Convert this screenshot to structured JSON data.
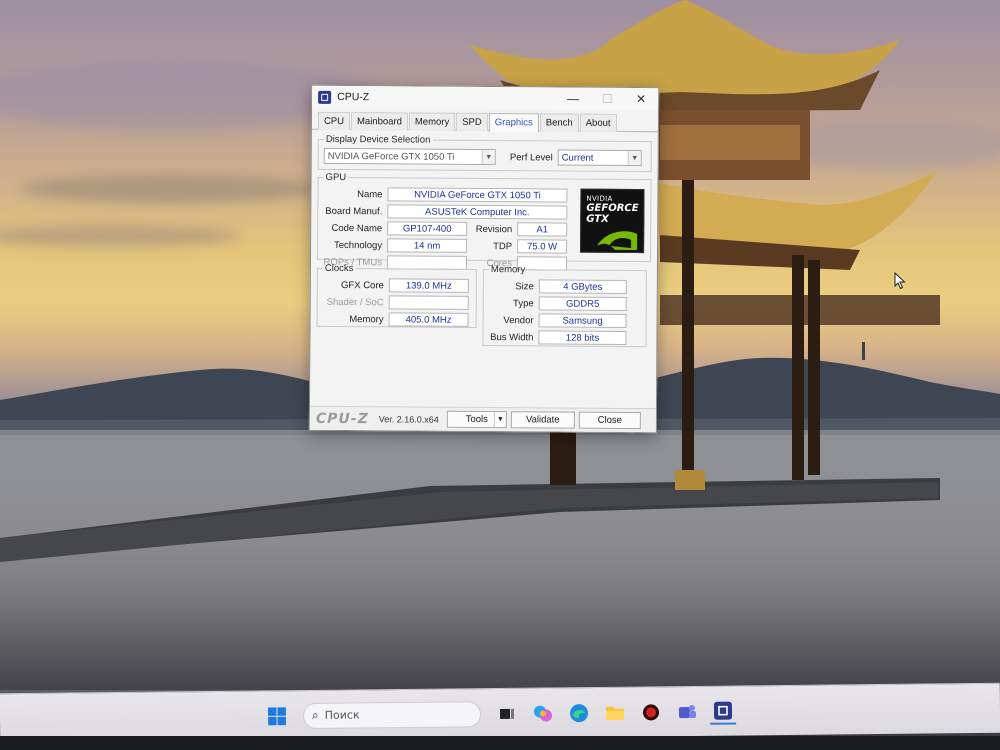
{
  "window": {
    "title": "CPU-Z",
    "minimize_glyph": "—",
    "maximize_glyph": "☐",
    "close_glyph": "✕"
  },
  "tabs": [
    {
      "label": "CPU",
      "active": false
    },
    {
      "label": "Mainboard",
      "active": false
    },
    {
      "label": "Memory",
      "active": false
    },
    {
      "label": "SPD",
      "active": false
    },
    {
      "label": "Graphics",
      "active": true
    },
    {
      "label": "Bench",
      "active": false
    },
    {
      "label": "About",
      "active": false
    }
  ],
  "display_selection": {
    "legend": "Display Device Selection",
    "device": "NVIDIA GeForce GTX 1050 Ti",
    "perf_label": "Perf Level",
    "perf_value": "Current"
  },
  "gpu": {
    "legend": "GPU",
    "name_label": "Name",
    "name": "NVIDIA GeForce GTX 1050 Ti",
    "board_label": "Board Manuf.",
    "board": "ASUSTeK Computer Inc.",
    "code_label": "Code Name",
    "code": "GP107-400",
    "revision_label": "Revision",
    "revision": "A1",
    "tech_label": "Technology",
    "tech": "14 nm",
    "tdp_label": "TDP",
    "tdp": "75.0 W",
    "rops_label": "ROPs / TMUs",
    "rops": "",
    "cores_label": "Cores",
    "cores": ""
  },
  "logo": {
    "line1": "NVIDIA",
    "line2": "GEFORCE",
    "line3": "GTX"
  },
  "clocks": {
    "legend": "Clocks",
    "gfx_label": "GFX Core",
    "gfx": "139.0 MHz",
    "shader_label": "Shader / SoC",
    "shader": "",
    "mem_label": "Memory",
    "mem": "405.0 MHz"
  },
  "memory": {
    "legend": "Memory",
    "size_label": "Size",
    "size": "4 GBytes",
    "type_label": "Type",
    "type": "GDDR5",
    "vendor_label": "Vendor",
    "vendor": "Samsung",
    "bus_label": "Bus Width",
    "bus": "128 bits"
  },
  "footer": {
    "brand": "CPU-Z",
    "version": "Ver. 2.16.0.x64",
    "tools": "Tools",
    "validate": "Validate",
    "close": "Close"
  },
  "taskbar": {
    "search_placeholder": "Поиск",
    "apps": [
      "windows-start-icon",
      "task-view-icon",
      "copilot-icon",
      "edge-icon",
      "file-explorer-icon",
      "app-red-icon",
      "teams-icon",
      "cpuz-taskbar-icon"
    ]
  },
  "colors": {
    "accent_tab": "#2f50c8",
    "value_text": "#2030a0"
  }
}
